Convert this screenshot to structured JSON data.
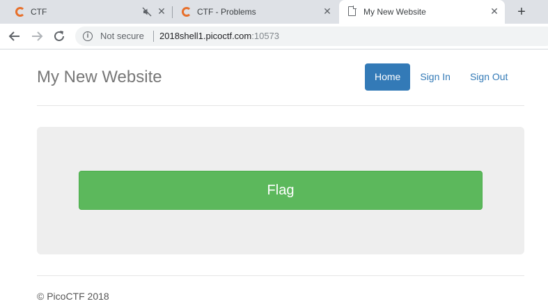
{
  "browser": {
    "tabs": [
      {
        "title": "CTF",
        "favicon": "ctf-c-icon"
      },
      {
        "title": "CTF - Problems",
        "favicon": "ctf-c-icon"
      },
      {
        "title": "My New Website",
        "favicon": "document-icon",
        "active": true
      }
    ],
    "close_glyph": "✕",
    "new_tab_glyph": "+",
    "omnibox": {
      "security_label": "Not secure",
      "host": "2018shell1.picoctf.com",
      "port": ":10573"
    }
  },
  "site": {
    "title": "My New Website",
    "nav": [
      "Home",
      "Sign In",
      "Sign Out"
    ],
    "flag_button": "Flag",
    "footer": "© PicoCTF 2018"
  },
  "colors": {
    "primary": "#337ab7",
    "success": "#5cb85c",
    "favicon_accent": "#e76f2a"
  }
}
